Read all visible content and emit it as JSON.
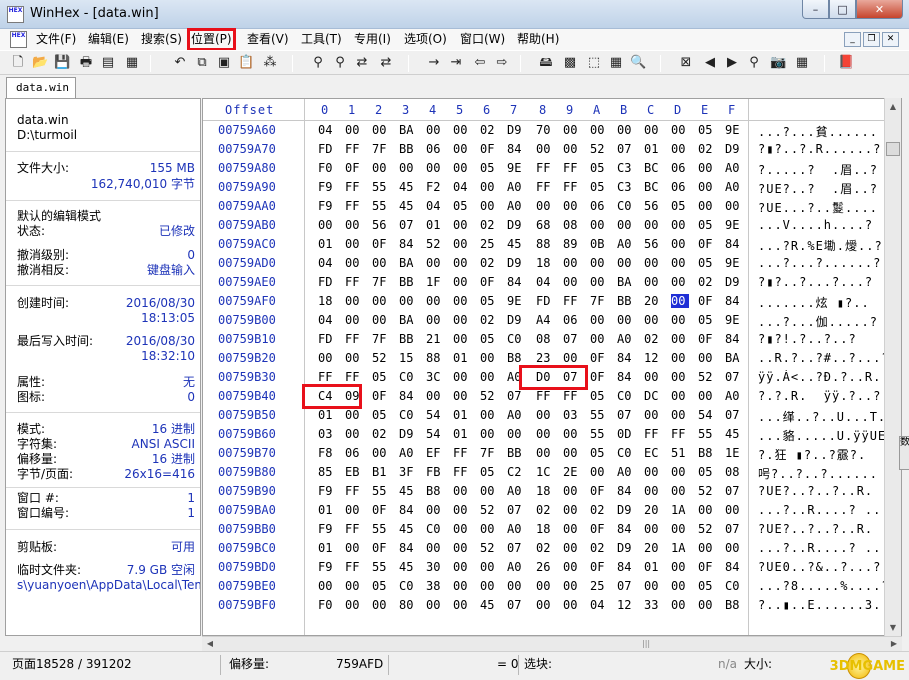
{
  "window": {
    "title": "WinHex - [data.win]",
    "minimize": "–",
    "maximize": "□",
    "close": "✕"
  },
  "app_icon": {
    "top": "HEX",
    "bottom": "WORKSHOP"
  },
  "menu": [
    "文件(F)",
    "编辑(E)",
    "搜索(S)",
    "位置(P)",
    "查看(V)",
    "工具(T)",
    "专用(I)",
    "选项(O)",
    "窗口(W)",
    "帮助(H)"
  ],
  "menu_highlight_index": 3,
  "mdi": {
    "minimize": "_",
    "restore": "❐",
    "close": "✕"
  },
  "tab": {
    "label": "data.win"
  },
  "info": {
    "file_name": "data.win",
    "file_path": "D:\\turmoil",
    "size_label": "文件大小:",
    "size_mb": "155 MB",
    "size_bytes": "162,740,010 字节",
    "edit_mode_label": "默认的编辑模式",
    "status_label": "状态:",
    "status_value": "已修改",
    "undo_level_label": "撤消级别:",
    "undo_level_value": "0",
    "undo_reverse_label": "撤消相反:",
    "undo_reverse_value": "键盘输入",
    "created_label": "创建时间:",
    "created_date": "2016/08/30",
    "created_time": "18:13:05",
    "written_label": "最后写入时间:",
    "written_date": "2016/08/30",
    "written_time": "18:32:10",
    "attr_label": "属性:",
    "attr_value": "无",
    "icon_label": "图标:",
    "icon_value": "0",
    "mode_label": "模式:",
    "mode_value": "16 进制",
    "charset_label": "字符集:",
    "charset_value": "ANSI ASCII",
    "offset_label": "偏移量:",
    "offset_value": "16 进制",
    "bpp_label": "字节/页面:",
    "bpp_value": "26x16=416",
    "window_num_label": "窗口 #:",
    "window_num_value": "1",
    "window_id_label": "窗口编号:",
    "window_id_value": "1",
    "clipboard_label": "剪贴板:",
    "clipboard_value": "可用",
    "temp_label": "临时文件夹:",
    "temp_value": "7.9 GB 空闲",
    "temp_path": "s\\yuanyoen\\AppData\\Local\\Temp"
  },
  "hex": {
    "offset_header": "Offset",
    "columns": [
      "0",
      "1",
      "2",
      "3",
      "4",
      "5",
      "6",
      "7",
      "8",
      "9",
      "A",
      "B",
      "C",
      "D",
      "E",
      "F"
    ],
    "rows": [
      {
        "offset": "00759A60",
        "bytes": [
          "04",
          "00",
          "00",
          "BA",
          "00",
          "00",
          "02",
          "D9",
          "70",
          "00",
          "00",
          "00",
          "00",
          "00",
          "05",
          "9E"
        ],
        "ascii": "...?...貧......"
      },
      {
        "offset": "00759A70",
        "bytes": [
          "FD",
          "FF",
          "7F",
          "BB",
          "06",
          "00",
          "0F",
          "84",
          "00",
          "00",
          "52",
          "07",
          "01",
          "00",
          "02",
          "D9"
        ],
        "ascii": "?▮?..?.R......?"
      },
      {
        "offset": "00759A80",
        "bytes": [
          "F0",
          "0F",
          "00",
          "00",
          "00",
          "00",
          "05",
          "9E",
          "FF",
          "FF",
          "05",
          "C3",
          "BC",
          "06",
          "00",
          "A0"
        ],
        "ascii": "?.....?  .眉..?"
      },
      {
        "offset": "00759A90",
        "bytes": [
          "F9",
          "FF",
          "55",
          "45",
          "F2",
          "04",
          "00",
          "A0",
          "FF",
          "FF",
          "05",
          "C3",
          "BC",
          "06",
          "00",
          "A0"
        ],
        "ascii": "?UE?..?  .眉..?"
      },
      {
        "offset": "00759AA0",
        "bytes": [
          "F9",
          "FF",
          "55",
          "45",
          "04",
          "05",
          "00",
          "A0",
          "00",
          "00",
          "06",
          "C0",
          "56",
          "05",
          "00",
          "00"
        ],
        "ascii": "?UE...?..鬉...."
      },
      {
        "offset": "00759AB0",
        "bytes": [
          "00",
          "00",
          "56",
          "07",
          "01",
          "00",
          "02",
          "D9",
          "68",
          "08",
          "00",
          "00",
          "00",
          "00",
          "05",
          "9E"
        ],
        "ascii": "...V....h....?"
      },
      {
        "offset": "00759AC0",
        "bytes": [
          "01",
          "00",
          "0F",
          "84",
          "52",
          "00",
          "25",
          "45",
          "88",
          "89",
          "0B",
          "A0",
          "56",
          "00",
          "0F",
          "84"
        ],
        "ascii": "...?R.%E墈.燰..?"
      },
      {
        "offset": "00759AD0",
        "bytes": [
          "04",
          "00",
          "00",
          "BA",
          "00",
          "00",
          "02",
          "D9",
          "18",
          "00",
          "00",
          "00",
          "00",
          "00",
          "05",
          "9E"
        ],
        "ascii": "...?...?......?"
      },
      {
        "offset": "00759AE0",
        "bytes": [
          "FD",
          "FF",
          "7F",
          "BB",
          "1F",
          "00",
          "0F",
          "84",
          "04",
          "00",
          "00",
          "BA",
          "00",
          "00",
          "02",
          "D9"
        ],
        "ascii": "?▮?..?...?...?"
      },
      {
        "offset": "00759AF0",
        "bytes": [
          "18",
          "00",
          "00",
          "00",
          "00",
          "00",
          "05",
          "9E",
          "FD",
          "FF",
          "7F",
          "BB",
          "20",
          "00",
          "0F",
          "84"
        ],
        "ascii": ".......炫 ▮?.."
      },
      {
        "offset": "00759B00",
        "bytes": [
          "04",
          "00",
          "00",
          "BA",
          "00",
          "00",
          "02",
          "D9",
          "A4",
          "06",
          "00",
          "00",
          "00",
          "00",
          "05",
          "9E"
        ],
        "ascii": "...?...伽.....?"
      },
      {
        "offset": "00759B10",
        "bytes": [
          "FD",
          "FF",
          "7F",
          "BB",
          "21",
          "00",
          "05",
          "C0",
          "08",
          "07",
          "00",
          "A0",
          "02",
          "00",
          "0F",
          "84"
        ],
        "ascii": "?▮?!.?..?..?"
      },
      {
        "offset": "00759B20",
        "bytes": [
          "00",
          "00",
          "52",
          "15",
          "88",
          "01",
          "00",
          "B8",
          "23",
          "00",
          "0F",
          "84",
          "12",
          "00",
          "00",
          "BA"
        ],
        "ascii": "..R.?..?#..?...?"
      },
      {
        "offset": "00759B30",
        "bytes": [
          "FF",
          "FF",
          "05",
          "C0",
          "3C",
          "00",
          "00",
          "A0",
          "D0",
          "07",
          "0F",
          "84",
          "00",
          "00",
          "52",
          "07"
        ],
        "ascii": "ÿÿ.À<..?Ð.?..R."
      },
      {
        "offset": "00759B40",
        "bytes": [
          "C4",
          "09",
          "0F",
          "84",
          "00",
          "00",
          "52",
          "07",
          "FF",
          "FF",
          "05",
          "C0",
          "DC",
          "00",
          "00",
          "A0"
        ],
        "ascii": "?.?.R.  ÿÿ.?..?"
      },
      {
        "offset": "00759B50",
        "bytes": [
          "01",
          "00",
          "05",
          "C0",
          "54",
          "01",
          "00",
          "A0",
          "00",
          "03",
          "55",
          "07",
          "00",
          "00",
          "54",
          "07"
        ],
        "ascii": "...缂..?..U...T."
      },
      {
        "offset": "00759B60",
        "bytes": [
          "03",
          "00",
          "02",
          "D9",
          "54",
          "01",
          "00",
          "00",
          "00",
          "00",
          "55",
          "0D",
          "FF",
          "FF",
          "55",
          "45"
        ],
        "ascii": "...貉.....U.ÿÿUE"
      },
      {
        "offset": "00759B70",
        "bytes": [
          "F8",
          "06",
          "00",
          "A0",
          "EF",
          "FF",
          "7F",
          "BB",
          "00",
          "00",
          "05",
          "C0",
          "EC",
          "51",
          "B8",
          "1E"
        ],
        "ascii": "?.狂 ▮?..?霢?."
      },
      {
        "offset": "00759B80",
        "bytes": [
          "85",
          "EB",
          "B1",
          "3F",
          "FB",
          "FF",
          "05",
          "C2",
          "1C",
          "2E",
          "00",
          "A0",
          "00",
          "00",
          "05",
          "08"
        ],
        "ascii": "呺?..?..?......"
      },
      {
        "offset": "00759B90",
        "bytes": [
          "F9",
          "FF",
          "55",
          "45",
          "B8",
          "00",
          "00",
          "A0",
          "18",
          "00",
          "0F",
          "84",
          "00",
          "00",
          "52",
          "07"
        ],
        "ascii": "?UE?..?..?..R."
      },
      {
        "offset": "00759BA0",
        "bytes": [
          "01",
          "00",
          "0F",
          "84",
          "00",
          "00",
          "52",
          "07",
          "02",
          "00",
          "02",
          "D9",
          "20",
          "1A",
          "00",
          "00"
        ],
        "ascii": "...?..R....? ..."
      },
      {
        "offset": "00759BB0",
        "bytes": [
          "F9",
          "FF",
          "55",
          "45",
          "C0",
          "00",
          "00",
          "A0",
          "18",
          "00",
          "0F",
          "84",
          "00",
          "00",
          "52",
          "07"
        ],
        "ascii": "?UE?..?..?..R."
      },
      {
        "offset": "00759BC0",
        "bytes": [
          "01",
          "00",
          "0F",
          "84",
          "00",
          "00",
          "52",
          "07",
          "02",
          "00",
          "02",
          "D9",
          "20",
          "1A",
          "00",
          "00"
        ],
        "ascii": "...?..R....? ..."
      },
      {
        "offset": "00759BD0",
        "bytes": [
          "F9",
          "FF",
          "55",
          "45",
          "30",
          "00",
          "00",
          "A0",
          "26",
          "00",
          "0F",
          "84",
          "01",
          "00",
          "0F",
          "84"
        ],
        "ascii": "?UE0..?&..?...?"
      },
      {
        "offset": "00759BE0",
        "bytes": [
          "00",
          "00",
          "05",
          "C0",
          "38",
          "00",
          "00",
          "00",
          "00",
          "00",
          "25",
          "07",
          "00",
          "00",
          "05",
          "C0"
        ],
        "ascii": "...?8.....%....?"
      },
      {
        "offset": "00759BF0",
        "bytes": [
          "F0",
          "00",
          "00",
          "80",
          "00",
          "00",
          "45",
          "07",
          "00",
          "00",
          "04",
          "12",
          "33",
          "00",
          "00",
          "B8"
        ],
        "ascii": "?..▮..E......3..?"
      }
    ]
  },
  "status": {
    "page": "页面18528 / 391202",
    "offset_label": "偏移量:",
    "offset_value": "759AFD",
    "value": "= 0",
    "block_label": "选块:",
    "nA": "n/a",
    "size_label": "大小:",
    "watermark": "3DMGAME",
    "side_tab": "数"
  }
}
